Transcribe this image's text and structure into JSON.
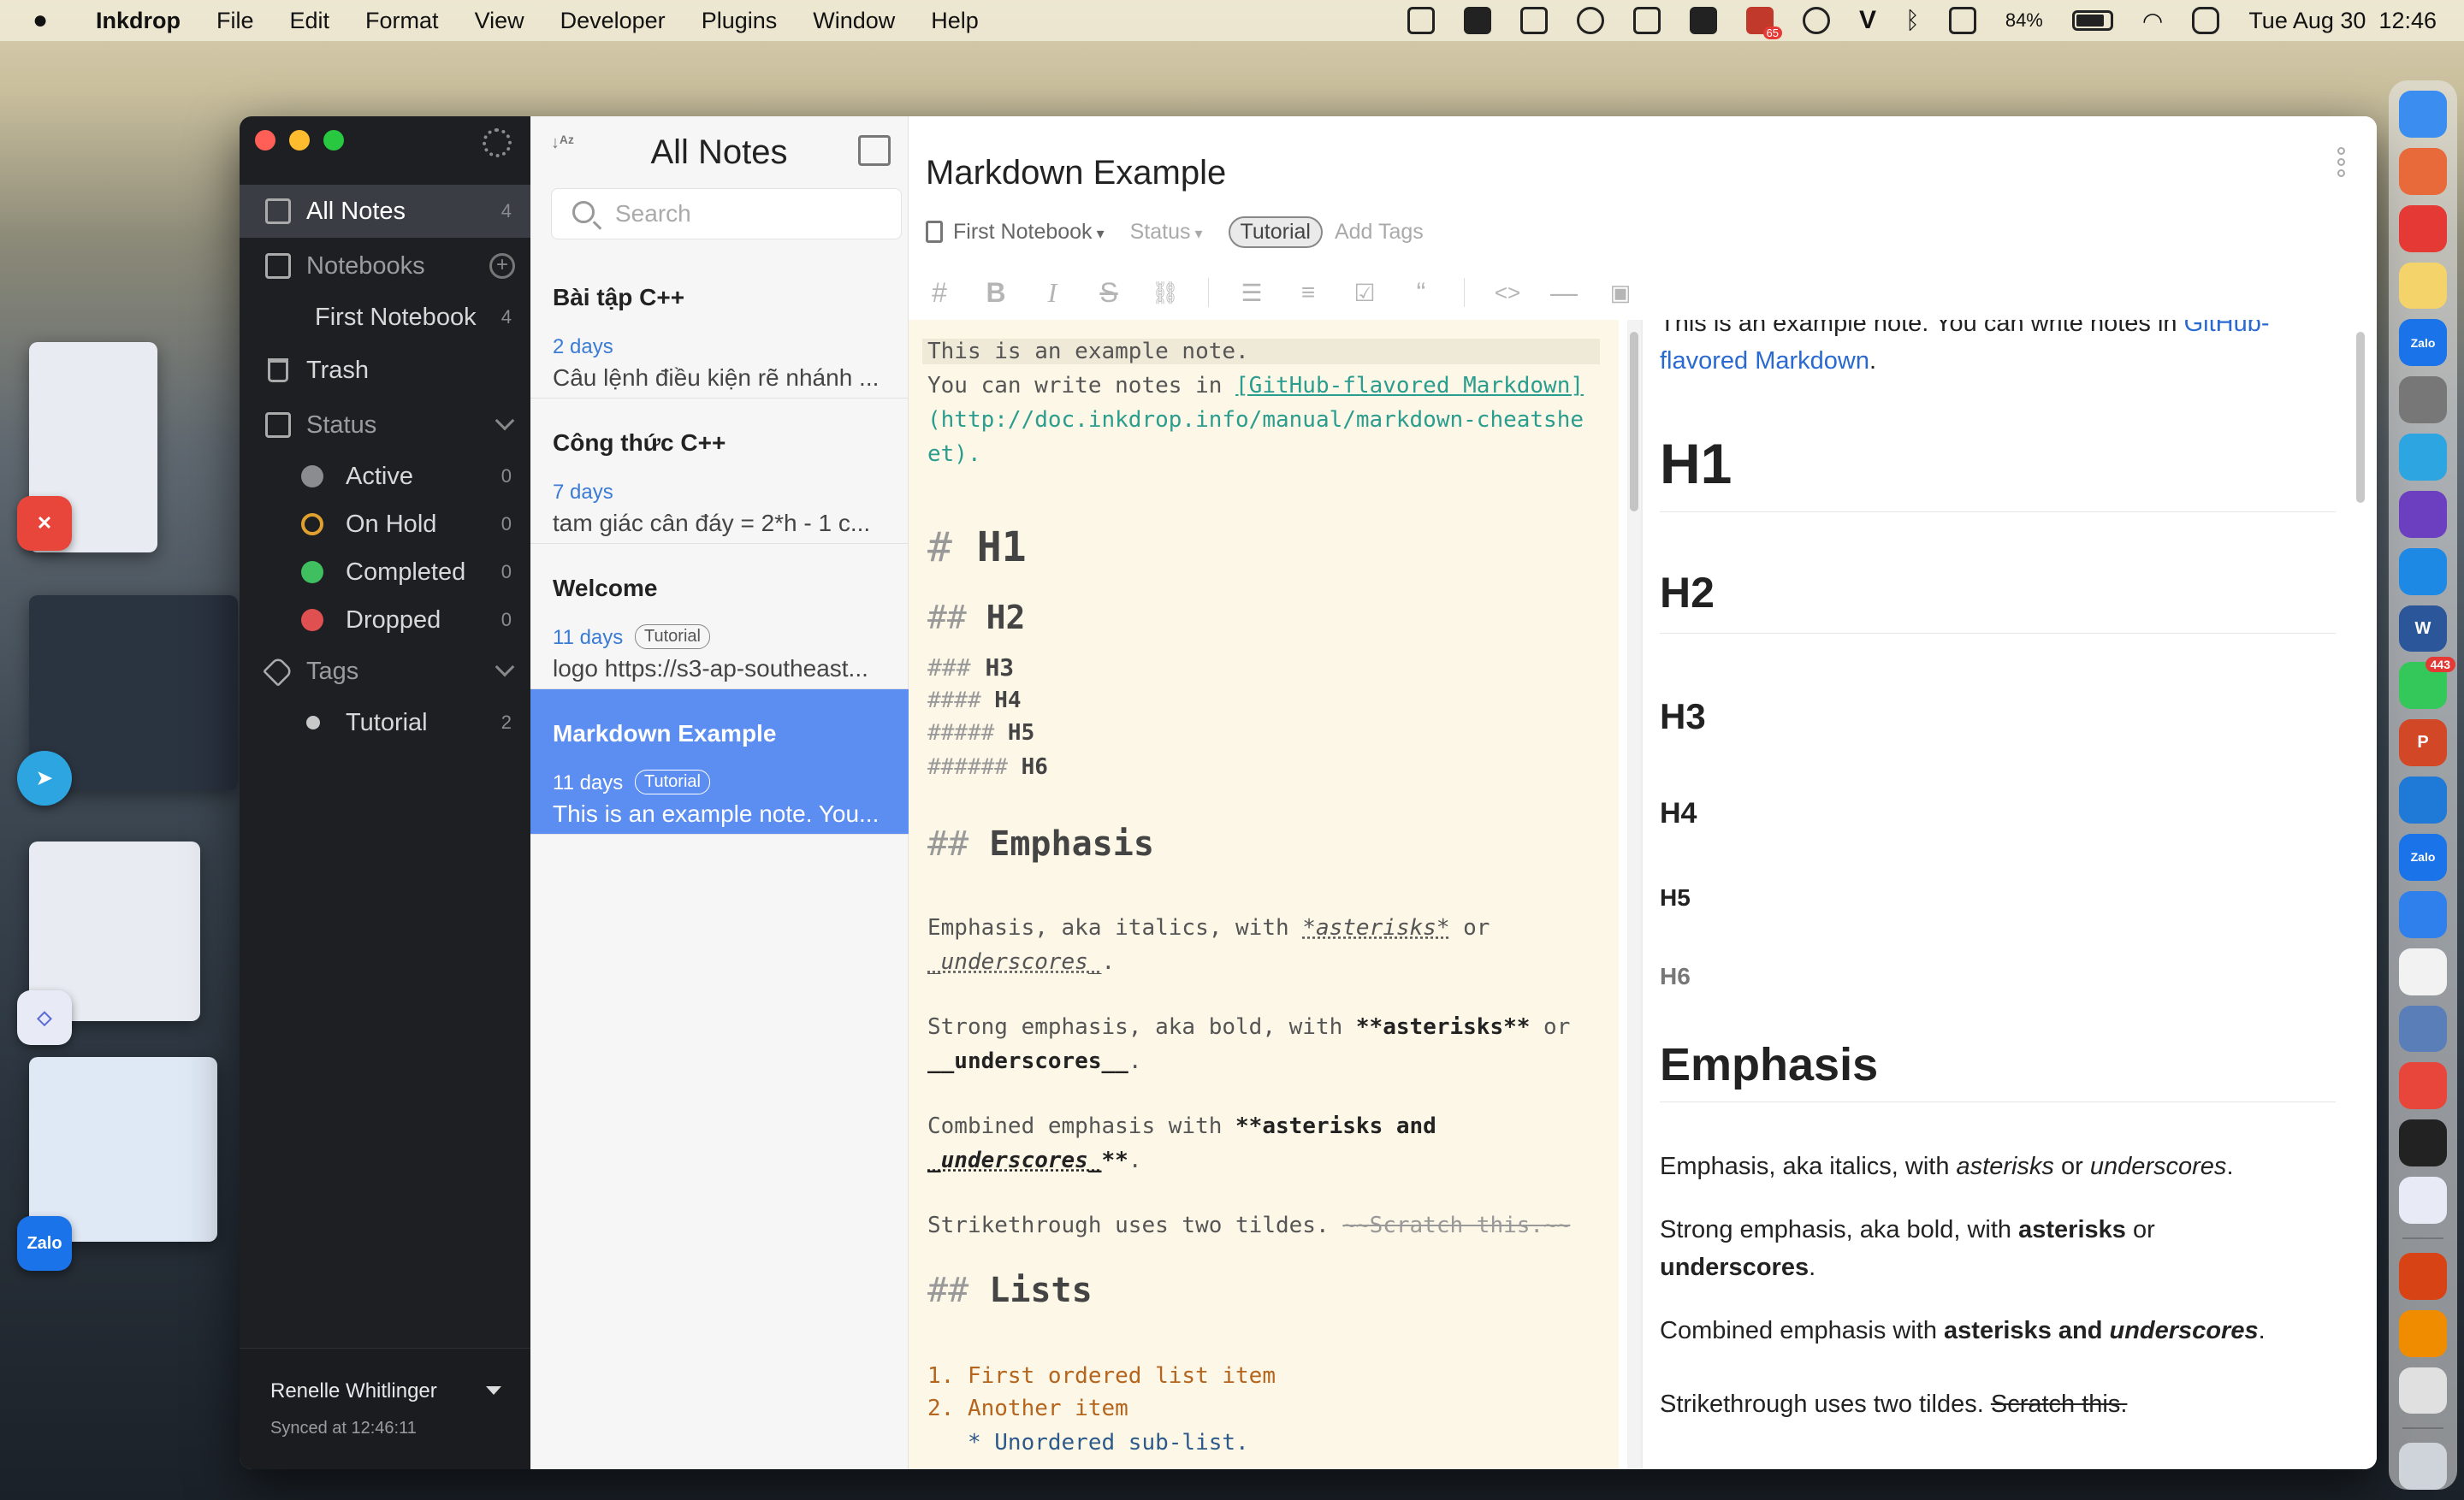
{
  "menubar": {
    "app_name": "Inkdrop",
    "menus": [
      "File",
      "Edit",
      "Format",
      "View",
      "Developer",
      "Plugins",
      "Window",
      "Help"
    ],
    "battery": "84%",
    "battery_level": 0.84,
    "datetime": "Tue Aug 30  12:46",
    "icons": [
      "apple-icon",
      "app-switcher-icon",
      "draw-icon",
      "direct-icon",
      "dropbox-icon",
      "display-icon",
      "s-app-icon",
      "notification-app-icon",
      "play-icon",
      "v-icon",
      "bluetooth-icon",
      "keyboard-icon",
      "wifi-icon",
      "control-center-icon"
    ],
    "notification_badge": "65"
  },
  "sidebar": {
    "all_notes": {
      "label": "All Notes",
      "count": "4"
    },
    "notebooks": {
      "label": "Notebooks"
    },
    "first_notebook": {
      "label": "First Notebook",
      "count": "4"
    },
    "trash": {
      "label": "Trash"
    },
    "status": {
      "label": "Status"
    },
    "status_items": [
      {
        "label": "Active",
        "count": "0",
        "color": "#8a8c90"
      },
      {
        "label": "On Hold",
        "count": "0",
        "color": "#e0a030"
      },
      {
        "label": "Completed",
        "count": "0",
        "color": "#3fbf5f"
      },
      {
        "label": "Dropped",
        "count": "0",
        "color": "#e05050"
      }
    ],
    "tags": {
      "label": "Tags"
    },
    "tag_items": [
      {
        "label": "Tutorial",
        "count": "2"
      }
    ],
    "footer": {
      "user": "Renelle Whitlinger",
      "sync": "Synced at 12:46:11"
    }
  },
  "notelist": {
    "title": "All Notes",
    "search_placeholder": "Search",
    "notes": [
      {
        "title": "Bài tập C++",
        "date": "2 days",
        "tag": "",
        "preview": "Câu lệnh điều kiện rẽ nhánh ..."
      },
      {
        "title": "Công thức C++",
        "date": "7 days",
        "tag": "",
        "preview": "tam giác cân đáy = 2*h - 1 c..."
      },
      {
        "title": "Welcome",
        "date": "11 days",
        "tag": "Tutorial",
        "preview": "logo https://s3-ap-southeast..."
      },
      {
        "title": "Markdown Example",
        "date": "11 days",
        "tag": "Tutorial",
        "preview": "This is an example note. You..."
      }
    ]
  },
  "editor": {
    "title": "Markdown Example",
    "notebook": "First Notebook",
    "status": "Status",
    "tag": "Tutorial",
    "add_tags": "Add Tags",
    "toolbar_icons": [
      "heading-icon",
      "bold-icon",
      "italic-icon",
      "strikethrough-icon",
      "link-icon",
      "bullet-list-icon",
      "numbered-list-icon",
      "checkbox-icon",
      "quote-icon",
      "code-icon",
      "horizontal-rule-icon",
      "image-icon"
    ]
  },
  "code": {
    "l1": "This is an example note.",
    "l2_pre": "You can write notes in ",
    "l2_link": "[GitHub-flavored Markdown]",
    "l3": "(http://doc.inkdrop.info/manual/markdown-cheatshe",
    "l4": "et).",
    "h1_hash": "# ",
    "h1": "H1",
    "h2_hash": "## ",
    "h2": "H2",
    "h3_hash": "### ",
    "h3": "H3",
    "h4_hash": "#### ",
    "h4": "H4",
    "h5_hash": "##### ",
    "h5": "H5",
    "h6_hash": "###### ",
    "h6": "H6",
    "emph_hash": "## ",
    "emph": "Emphasis",
    "e1a": "Emphasis, aka italics, with ",
    "e1b": "*asterisks*",
    "e1c": " or",
    "e2a": "_underscores_",
    "e2b": ".",
    "s1a": "Strong emphasis, aka bold, with ",
    "s1b": "**asterisks**",
    "s1c": " or",
    "s2a": "__underscores__",
    "s2b": ".",
    "c1a": "Combined emphasis with ",
    "c1b": "**asterisks and",
    "c2a": "_underscores_",
    "c2b": "**",
    "c2c": ".",
    "st_a": "Strikethrough uses two tildes. ",
    "st_b": "~~Scratch this.~~",
    "lists_hash": "## ",
    "lists": "Lists",
    "ol1": "1. First ordered list item",
    "ol2": "2. Another item",
    "ul1": "   * Unordered sub-list."
  },
  "preview": {
    "intro_a": "This is an example note. You can write notes in ",
    "intro_link1": "GitHub-",
    "intro_link2": "flavored Markdown",
    "intro_end": ".",
    "h1": "H1",
    "h2": "H2",
    "h3": "H3",
    "h4": "H4",
    "h5": "H5",
    "h6": "H6",
    "emphasis": "Emphasis",
    "p1a": "Emphasis, aka italics, with ",
    "p1b": "asterisks",
    "p1c": " or ",
    "p1d": "underscores",
    "p1e": ".",
    "p2a": "Strong emphasis, aka bold, with ",
    "p2b": "asterisks",
    "p2c": " or",
    "p2d": "underscores",
    "p2e": ".",
    "p3a": "Combined emphasis with ",
    "p3b": "asterisks and ",
    "p3c": "underscores",
    "p3d": ".",
    "p4a": "Strikethrough uses two tildes. ",
    "p4b": "Scratch this."
  },
  "dock": {
    "apps": [
      {
        "name": "finder-icon",
        "color": "#3b8ef0",
        "label": ""
      },
      {
        "name": "launchpad-icon",
        "color": "#e86a3a",
        "label": ""
      },
      {
        "name": "chrome-icon",
        "color": "#e53935",
        "label": ""
      },
      {
        "name": "notes-icon",
        "color": "#f5d36b",
        "label": ""
      },
      {
        "name": "zalo-icon",
        "color": "#1a73e8",
        "label": "Zalo"
      },
      {
        "name": "settings-icon",
        "color": "#777777",
        "label": ""
      },
      {
        "name": "telegram-icon",
        "color": "#2ca5e0",
        "label": ""
      },
      {
        "name": "imovie-icon",
        "color": "#6b3fbf",
        "label": ""
      },
      {
        "name": "appstore-icon",
        "color": "#1e88e5",
        "label": ""
      },
      {
        "name": "word-icon",
        "color": "#2b579a",
        "label": "W"
      },
      {
        "name": "messages-icon",
        "color": "#34c759",
        "label": "",
        "badge": "443"
      },
      {
        "name": "powerpoint-icon",
        "color": "#d24726",
        "label": "P"
      },
      {
        "name": "vscode-icon",
        "color": "#1e7ad6",
        "label": ""
      },
      {
        "name": "zalo-icon-2",
        "color": "#1a73e8",
        "label": "Zalo"
      },
      {
        "name": "safari-icon",
        "color": "#2f80ed",
        "label": ""
      },
      {
        "name": "textedit-icon",
        "color": "#f2f2f2",
        "label": ""
      },
      {
        "name": "preview-icon",
        "color": "#5a7fb8",
        "label": ""
      },
      {
        "name": "anydesk-icon",
        "color": "#e8463a",
        "label": ""
      },
      {
        "name": "terminal-icon",
        "color": "#222222",
        "label": ""
      },
      {
        "name": "inkdrop-icon",
        "color": "#e8eaf6",
        "label": ""
      },
      {
        "name": "remote-icon",
        "color": "#d84315",
        "label": ""
      },
      {
        "name": "vlc-icon",
        "color": "#f08c00",
        "label": ""
      },
      {
        "name": "pinwheel-icon",
        "color": "#e0e0e0",
        "label": ""
      },
      {
        "name": "trash-icon",
        "color": "#cfd4da",
        "label": ""
      }
    ]
  },
  "stage": {
    "zalo_label": "Zalo"
  }
}
